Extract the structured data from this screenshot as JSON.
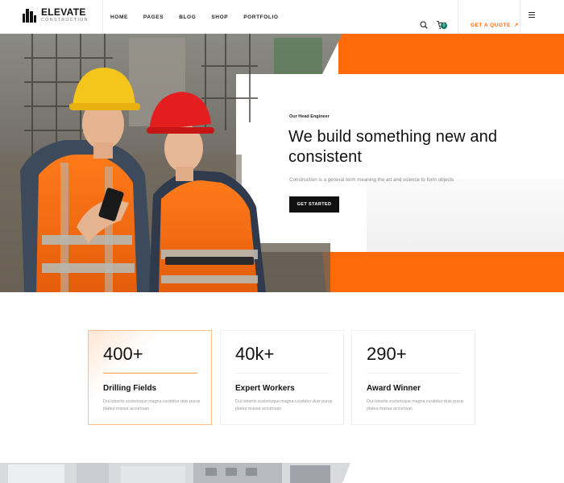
{
  "brand": {
    "name": "ELEVATE",
    "sub": "CONSTRUCTION"
  },
  "nav": {
    "items": [
      "HOME",
      "PAGES",
      "BLOG",
      "SHOP",
      "PORTFOLIO"
    ]
  },
  "header": {
    "cart_count": "0",
    "quote_label": "GET A QUOTE",
    "quote_arrow": "↗"
  },
  "hero": {
    "eyebrow": "Our Head Engineer",
    "title": "We build something new and consistent",
    "description": "Construction is a general term meaning the art and science to form objects",
    "cta_label": "GET STARTED"
  },
  "stats": [
    {
      "number": "400+",
      "title": "Drilling Fields",
      "text": "Dui lobortis scelerisque magna curabitur duis purus platea massa accumsan"
    },
    {
      "number": "40k+",
      "title": "Expert Workers",
      "text": "Dui lobortis scelerisque magna curabitur duis purus platea massa accumsan"
    },
    {
      "number": "290+",
      "title": "Award Winner",
      "text": "Dui lobortis scelerisque magna curabitur duis purus platea massa accumsan"
    }
  ],
  "colors": {
    "accent": "#ff6b0a",
    "badge": "#0e7c63",
    "dark": "#111111"
  },
  "icons": {
    "search": "search-icon",
    "cart": "cart-icon",
    "menu": "hamburger-menu-icon",
    "logo": "building-logo-icon"
  }
}
